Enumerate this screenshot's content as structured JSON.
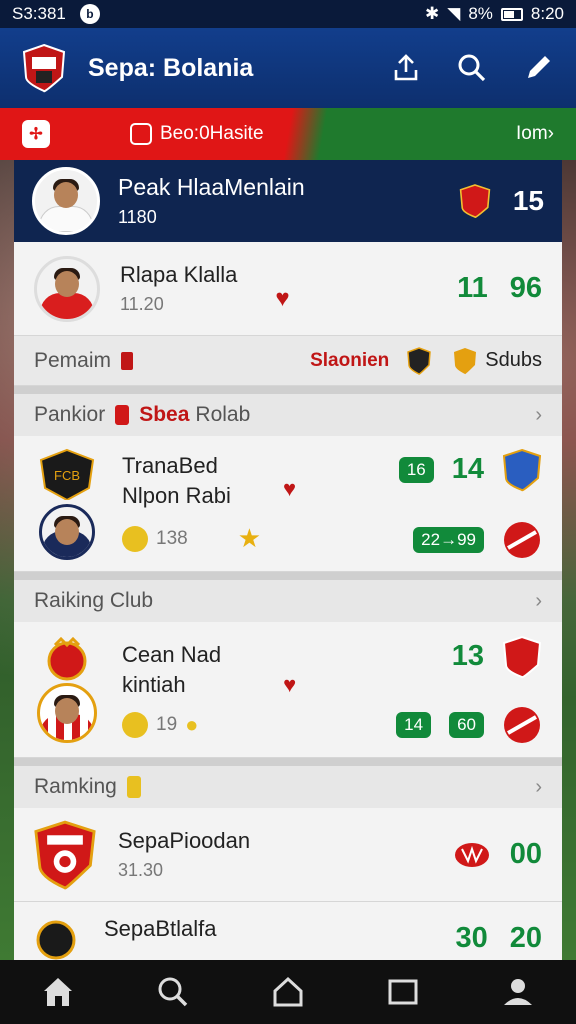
{
  "status_bar": {
    "left_text": "S3:381",
    "battery": "8%",
    "time": "8:20"
  },
  "app_bar": {
    "title": "Sepa: Bolania"
  },
  "banner": {
    "badge_glyph": "✢",
    "label": "Beo:0Hasite",
    "more": "Iom›"
  },
  "hero": {
    "name": "Peak HlaaMenlain",
    "sub": "1180",
    "score": "15"
  },
  "player_row": {
    "name": "Rlapa Klalla",
    "sub": "11.20",
    "value_a": "11",
    "value_b": "96"
  },
  "filter_row": {
    "left_label": "Pemaim",
    "mid_label": "Slaonien",
    "right_label": "Sdubs"
  },
  "section1": {
    "title_a": "Pankior",
    "title_b": "Sbea",
    "title_c": "Rolab",
    "chevron": "›",
    "item": {
      "line1": "TranaBed",
      "line2": "Nlpon Rabi",
      "points": "138",
      "pill_a": "16",
      "num_a": "14",
      "pill_b": "22→99"
    }
  },
  "section2": {
    "title": "Raiking Club",
    "chevron": "›",
    "item": {
      "line1": "Cean Nad",
      "line2": "kintiah",
      "points": "19",
      "num_a": "13",
      "pill_a": "14",
      "pill_b": "60"
    }
  },
  "section3": {
    "title": "Ramking",
    "chevron": "›",
    "item1": {
      "name": "SepaPioodan",
      "sub": "31.30",
      "num": "00"
    },
    "item2": {
      "name": "SepaBtlalfa",
      "num_a": "30",
      "num_b": "20"
    }
  },
  "bottom_nav": [
    "home-icon",
    "search-icon",
    "house-outline-icon",
    "square-icon",
    "profile-icon"
  ],
  "colors": {
    "primary": "#123e8c",
    "red": "#e01616",
    "green": "#118a3a"
  }
}
